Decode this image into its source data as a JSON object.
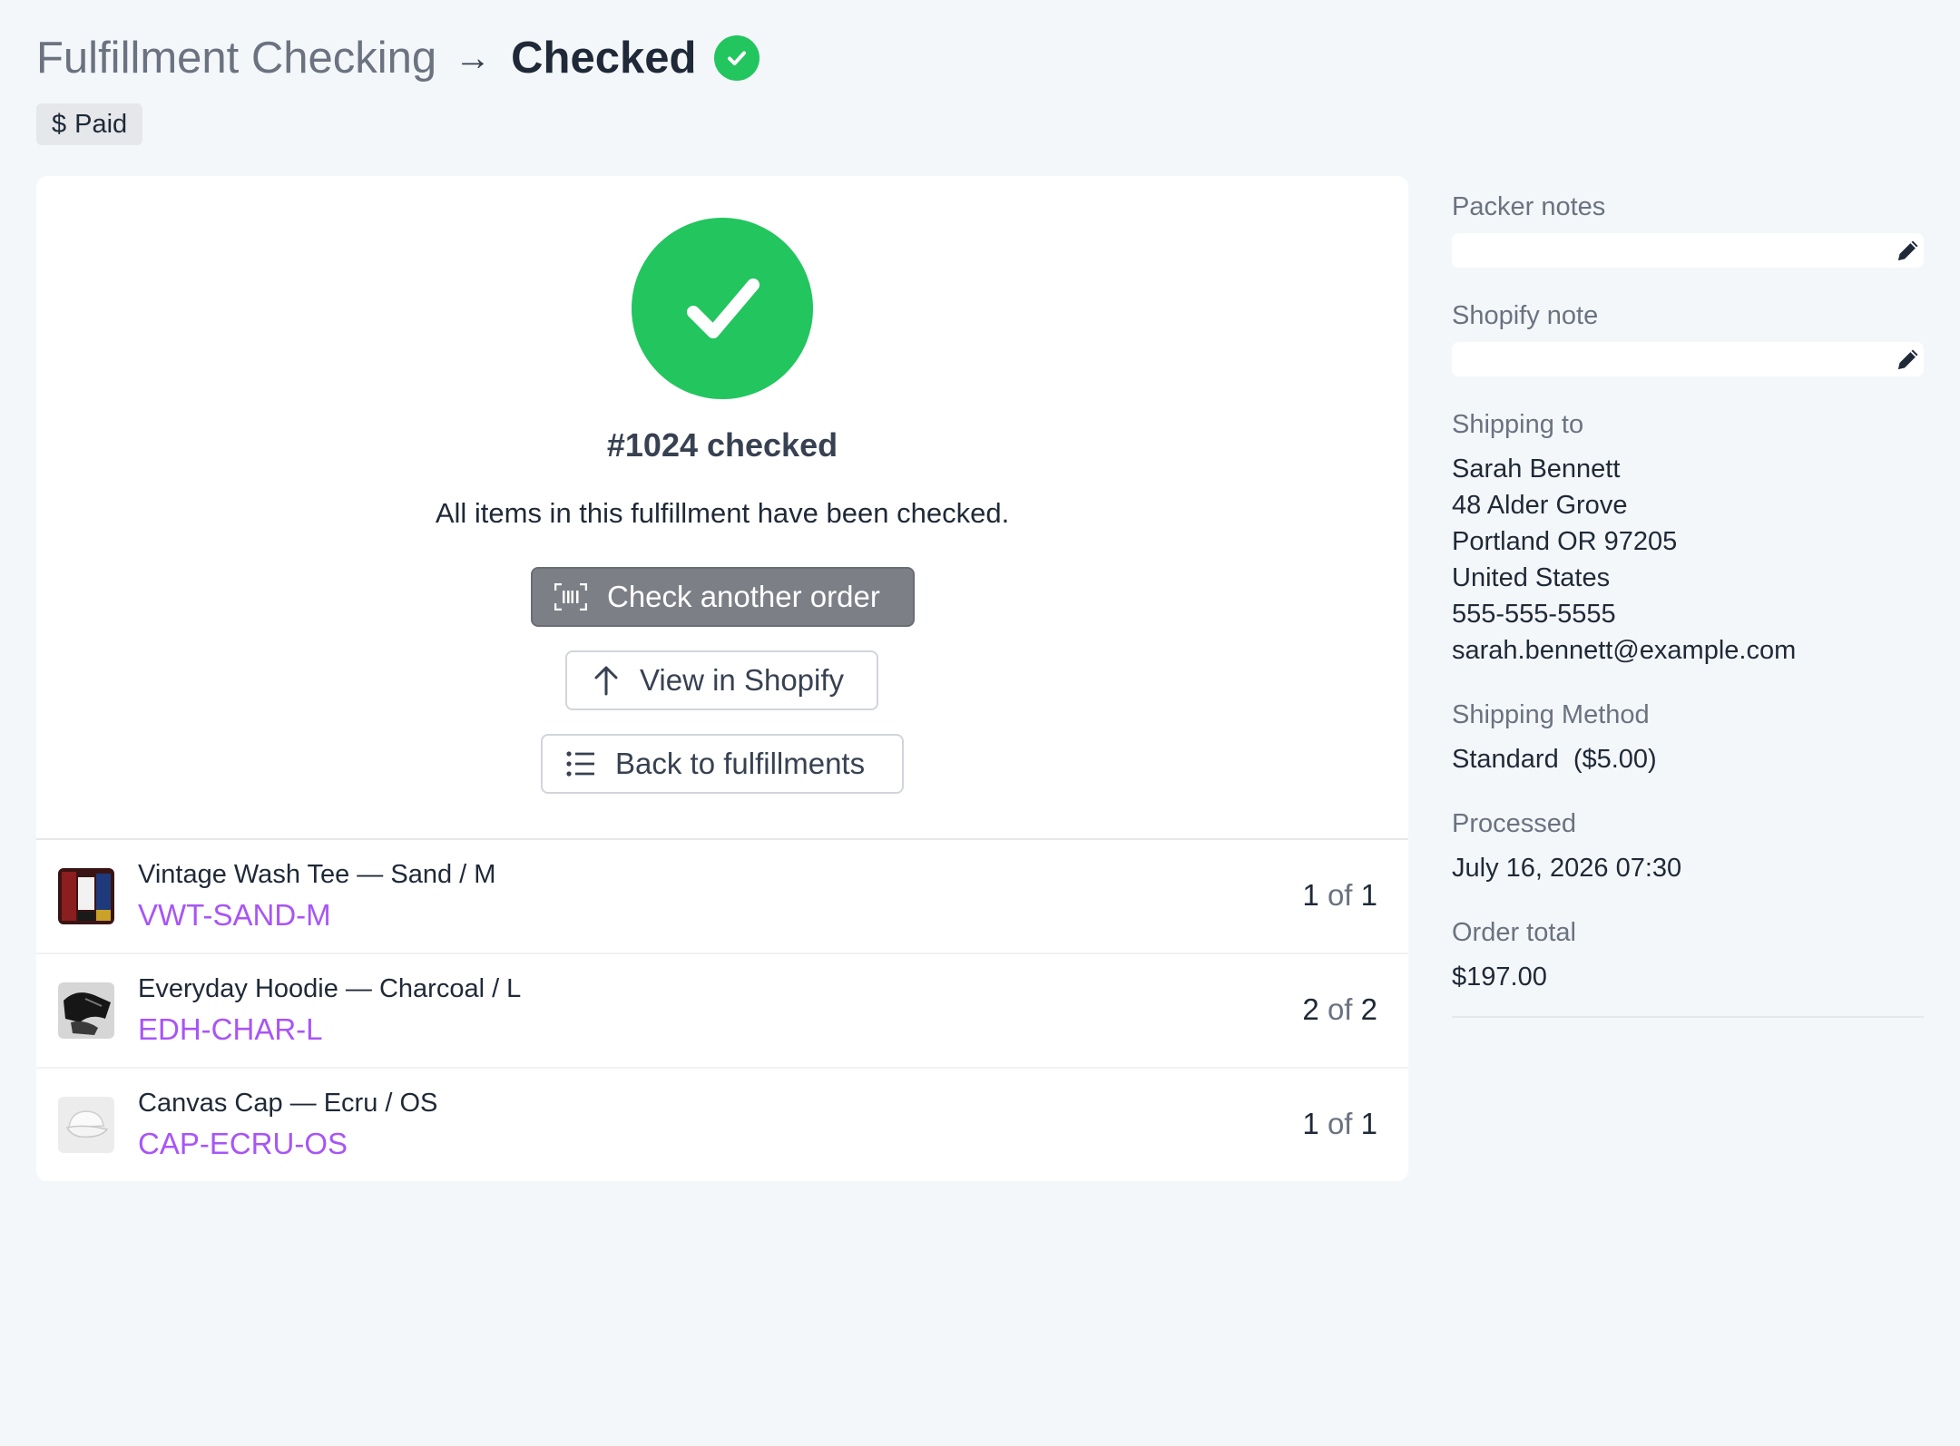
{
  "header": {
    "crumb": "Fulfillment Checking",
    "arrow": "→",
    "title": "Checked",
    "badge": {
      "symbol": "$",
      "label": "Paid"
    }
  },
  "hero": {
    "title": "#1024 checked",
    "description": "All items in this fulfillment have been checked.",
    "buttons": {
      "check_another": "Check another order",
      "view_shopify": "View in Shopify",
      "back": "Back to fulfillments"
    }
  },
  "items": [
    {
      "name": "Vintage Wash Tee — Sand / M",
      "sku": "VWT-SAND-M",
      "qty_checked": "1",
      "qty_of": "of",
      "qty_total": "1",
      "thumb": "tee-thumbnail"
    },
    {
      "name": "Everyday Hoodie — Charcoal / L",
      "sku": "EDH-CHAR-L",
      "qty_checked": "2",
      "qty_of": "of",
      "qty_total": "2",
      "thumb": "hoodie-thumbnail"
    },
    {
      "name": "Canvas Cap — Ecru / OS",
      "sku": "CAP-ECRU-OS",
      "qty_checked": "1",
      "qty_of": "of",
      "qty_total": "1",
      "thumb": "cap-thumbnail"
    }
  ],
  "sidebar": {
    "packer_notes": {
      "label": "Packer notes",
      "value": ""
    },
    "shopify_note": {
      "label": "Shopify note",
      "value": ""
    },
    "shipping_to": {
      "label": "Shipping to",
      "name": "Sarah Bennett",
      "street": "48 Alder Grove",
      "city": "Portland OR 97205",
      "country": "United States",
      "phone": "555-555-5555",
      "email": "sarah.bennett@example.com"
    },
    "shipping_method": {
      "label": "Shipping Method",
      "value": "Standard  ($5.00)"
    },
    "processed": {
      "label": "Processed",
      "value": "July 16, 2026 07:30"
    },
    "order_total": {
      "label": "Order total",
      "value": "$197.00"
    }
  },
  "colors": {
    "success": "#22c55e",
    "sku": "#a855f7",
    "primary_button": "#7d7f87",
    "background": "#f4f7fa"
  },
  "icons": {
    "title_check": "check-circle-icon",
    "hero_check": "check-circle-icon",
    "check_another": "barcode-scan-icon",
    "view_shopify": "arrow-up-icon",
    "back": "list-icon",
    "edit": "pencil-icon"
  }
}
